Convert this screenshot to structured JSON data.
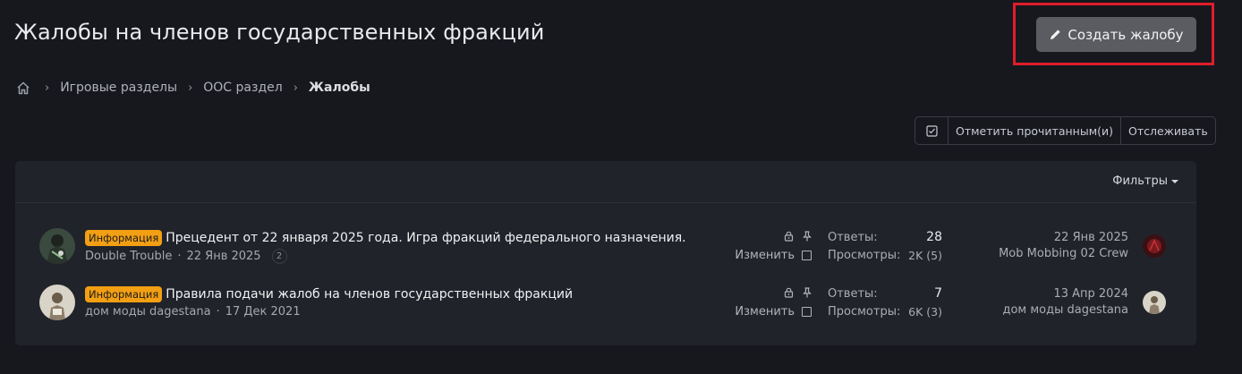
{
  "page": {
    "title": "Жалобы на членов государственных фракций",
    "create_button": "Создать жалобу"
  },
  "breadcrumb": {
    "home_icon": "home-icon",
    "items": [
      "Игровые разделы",
      "ООС раздел",
      "Жалобы"
    ]
  },
  "actions": {
    "mark_read_icon": "checkbox-check-icon",
    "mark_read": "Отметить прочитанным(и)",
    "watch": "Отслеживать"
  },
  "filters_label": "Фильтры",
  "threads": [
    {
      "prefix": "Информация",
      "title": "Прецедент от 22 января 2025 года. Игра фракций федерального назначения.",
      "author": "Double Trouble",
      "date": "22 Янв 2025",
      "pages": "2",
      "edit_label": "Изменить",
      "replies_label": "Ответы:",
      "replies": "28",
      "views_label": "Просмотры:",
      "views": "2K (5)",
      "last_date": "22 Янв 2025",
      "last_user": "Mob Mobbing 02 Crew"
    },
    {
      "prefix": "Информация",
      "title": "Правила подачи жалоб на членов государственных фракций",
      "author": "дом моды dagestana",
      "date": "17 Дек 2021",
      "edit_label": "Изменить",
      "replies_label": "Ответы:",
      "replies": "7",
      "views_label": "Просмотры:",
      "views": "6K (3)",
      "last_date": "13 Апр 2024",
      "last_user": "дом моды dagestana"
    }
  ],
  "colors": {
    "background": "#17181e",
    "panel": "#21232a",
    "prefix": "#f29f13",
    "button": "#5a5c62",
    "highlight": "#e01e2b"
  }
}
